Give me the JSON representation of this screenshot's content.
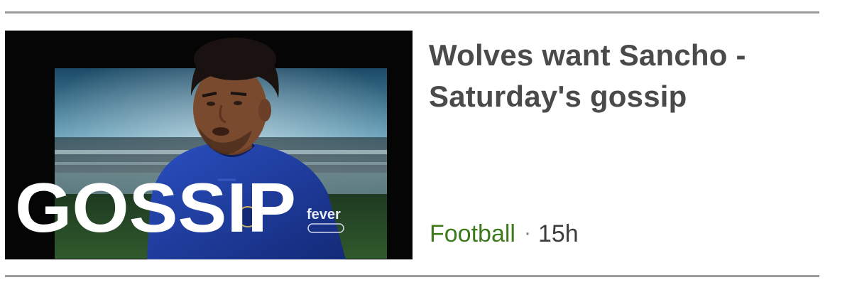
{
  "story": {
    "headline": "Wolves want Sancho - Saturday's gossip",
    "image_overlay_text": "GOSSIP",
    "shirt_text": "fever",
    "topic": "Football",
    "separator": "·",
    "age": "15h"
  },
  "colors": {
    "headline": "#4a4a4a",
    "topic": "#3d7a1c",
    "divider": "#9a9a9a",
    "image_background": "#050505",
    "kit_blue": "#1f3fa6"
  }
}
